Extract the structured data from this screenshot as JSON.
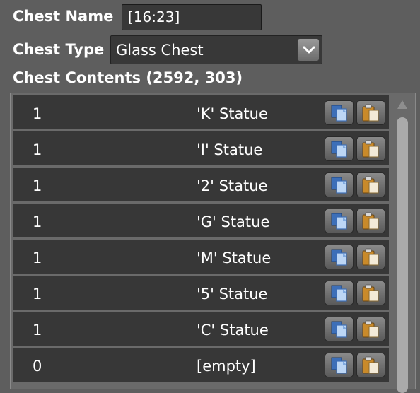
{
  "labels": {
    "chest_name": "Chest Name",
    "chest_type": "Chest Type",
    "chest_contents": "Chest Contents (2592, 303)"
  },
  "chest_name_value": "[16:23]",
  "chest_type_value": "Glass Chest",
  "rows": [
    {
      "qty": "1",
      "item": "'K' Statue"
    },
    {
      "qty": "1",
      "item": "'I' Statue"
    },
    {
      "qty": "1",
      "item": "'2' Statue"
    },
    {
      "qty": "1",
      "item": "'G' Statue"
    },
    {
      "qty": "1",
      "item": "'M' Statue"
    },
    {
      "qty": "1",
      "item": "'5' Statue"
    },
    {
      "qty": "1",
      "item": "'C' Statue"
    },
    {
      "qty": "0",
      "item": "[empty]"
    }
  ],
  "icons": {
    "copy": "copy-icon",
    "paste": "paste-icon",
    "dropdown": "chevron-down-icon",
    "scroll_up": "scroll-up-arrow"
  },
  "colors": {
    "background": "#5e5e5e",
    "row_background": "#373737",
    "copy_page": "#5b8fd4",
    "paste_clipboard": "#d9962e"
  }
}
